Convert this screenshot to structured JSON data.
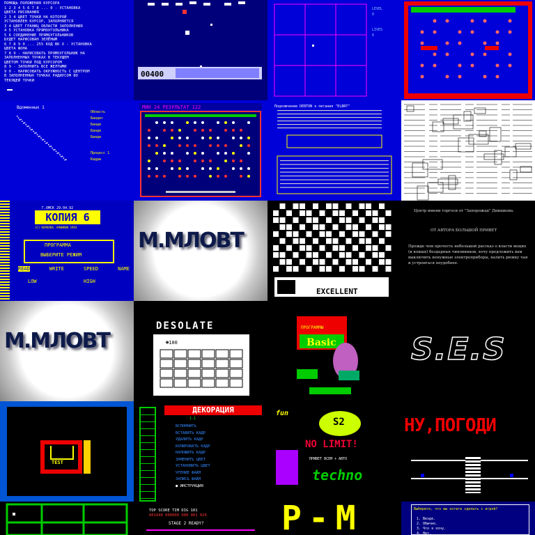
{
  "gallery": {
    "tiles": [
      {
        "id": "help",
        "lines": [
          "ПОМОЩЬ ПОЛОЖЕНИЯ КУРСОРА",
          "1 2 3 4 5 6 7 8 ... 0 - УСТАНОВКА",
          "ЦВЕТА РИСОВАНИЯ",
          "2 3 4 ЦВЕТ ТОЧКИ НА КОТОРОЙ",
          "УСТАНОВЛЕН КУРСОР, ЗАПОЛНЯЕТСЯ",
          "3 4 ЦВЕТ ГРАНИЦ ОБЛАСТИ ЗАПОЛНЕНИЯ",
          "4 5 УСТАНОВКА ПРЯМОУГОЛЬНИКА",
          "5 6 СОЕДИНЕНИЕ ПРЯМОУГОЛЬНИКОВ",
          "БУДЕТ НАРИСОВАН ЗЕЛЁНЫМ",
          "6 7 8 9 0 ... 255 КОД ВК Х - УСТАНОВКА",
          "ЦВЕТА ФОНА",
          "7 8 9 - НАРИСОВАТЬ ПРЯМОУГОЛЬНИК НА",
          "ЗАПОЛНЕННЫХ ТОЧКАХ В ТЕКУЩЕМ",
          "ЦВЕТОМ ТОЧКИ ПОД КУРСОРОМ",
          "8 9 - ЗАПОЛНИТЬ ВСЕ ЖЕЛТЫМИ",
          "9 0 - НАРИСОВАТЬ ОКРУЖНОСТЬ С ЦЕНТРОМ",
          "В ЗАПОЛНЕННЫХ ТОЧКАХ РАДИУСОМ ВО",
          "ТЕКУЩЕЙ ТОЧКИ"
        ]
      },
      {
        "id": "invaders",
        "score": "00400"
      },
      {
        "id": "grid-red",
        "labels": [
          "LEVEL",
          "0",
          "LIVES",
          "6"
        ]
      },
      {
        "id": "maze-red"
      },
      {
        "id": "plot",
        "title": "Bдоменных 1",
        "labels": [
          "Область",
          "Бандит",
          "Банди",
          "Банди",
          "Банди",
          "Процесс 1",
          "Кадры"
        ]
      },
      {
        "id": "breakout",
        "hud": [
          "МИН",
          "24",
          "РЕЗУЛЬТАТ",
          "122"
        ]
      },
      {
        "id": "doc",
        "title": "Подключение DEBTON к питания \"ELBRT\""
      },
      {
        "id": "schematic"
      },
      {
        "id": "kopiya",
        "date": "Г.ОМСК 29.04.92",
        "title": "КОПИЯ 6",
        "sub": "(C) КОРОЛЕВ, КРЫНКИН 1993",
        "menu": [
          "ПРОГРАММА",
          "ВЫБЕРИТЕ РЕЖИМ"
        ],
        "opts": [
          "READ",
          "WRITE",
          "SPEED",
          "NAME"
        ],
        "speed": [
          "LOW",
          "HIGH"
        ]
      },
      {
        "id": "logo1",
        "text": "M.MЛOBT"
      },
      {
        "id": "maze-white",
        "brand": "EXCELLENT"
      },
      {
        "id": "story",
        "header": "Центр имени торгоси от \"Запорожца\" Днишкова.",
        "title": "ОТ АВТОРА БОЛЬШОЙ ПРИВЕТ",
        "body": "Прежде чем прочесть небольшой рассказ о власти вещих (и коишх) бездарных чиновников, хочу предложить вам выключить ненужные электроприборы, налить рюмку чая и устроиться поудобнее."
      },
      {
        "id": "logo2",
        "text": "M.MЛOBT"
      },
      {
        "id": "desolate",
        "title": "DESOLATE",
        "score": "100"
      },
      {
        "id": "basic",
        "title": "Basic",
        "top": "ПРОГРАММЫ"
      },
      {
        "id": "ses",
        "text": "S.E.S"
      },
      {
        "id": "test",
        "text": "TEST"
      },
      {
        "id": "dekoration",
        "title": "ДЕКОРАЦИЯ",
        "ver": "1.1",
        "items": [
          "ВСПОМНИТЬ",
          "ВСТАВИТЬ КАДР",
          "УДАЛИТЬ КАДР",
          "КОПИРОВАТЬ КАДР",
          "НАЛОЖИТЬ КАДР",
          "ЗАМЕНИТЬ ЦВЕТ",
          "УСТАНОВИТЬ ЦВЕТ",
          "ЧТЕНИЕ ФАЙЛ",
          "ЗАПИСЬ ФАЙЛ",
          "ИНСТРУКЦИЯ"
        ]
      },
      {
        "id": "nolimit",
        "fun": "fun",
        "s2": "S2",
        "nolimit": "NO LIMIT!",
        "greet": "ПРИВЕТ ВСЕМ + АВТО",
        "techno": "techno"
      },
      {
        "id": "nupogodi",
        "title": "НУ,ПОГОДИ"
      },
      {
        "id": "green-grid"
      },
      {
        "id": "stage",
        "hud": "TOP SCORE TIM DIG 101",
        "scores": "001940 000600 000 001 020",
        "stage": "STAGE 2 READY?"
      },
      {
        "id": "pm",
        "text": "P-M"
      },
      {
        "id": "quiz",
        "q": "Выберите, что вы хотите сделать с игрой?",
        "opts": [
          "1. Везде.",
          "2. Обычно.",
          "3. Что я хочу.",
          "4. Нет."
        ]
      }
    ]
  }
}
